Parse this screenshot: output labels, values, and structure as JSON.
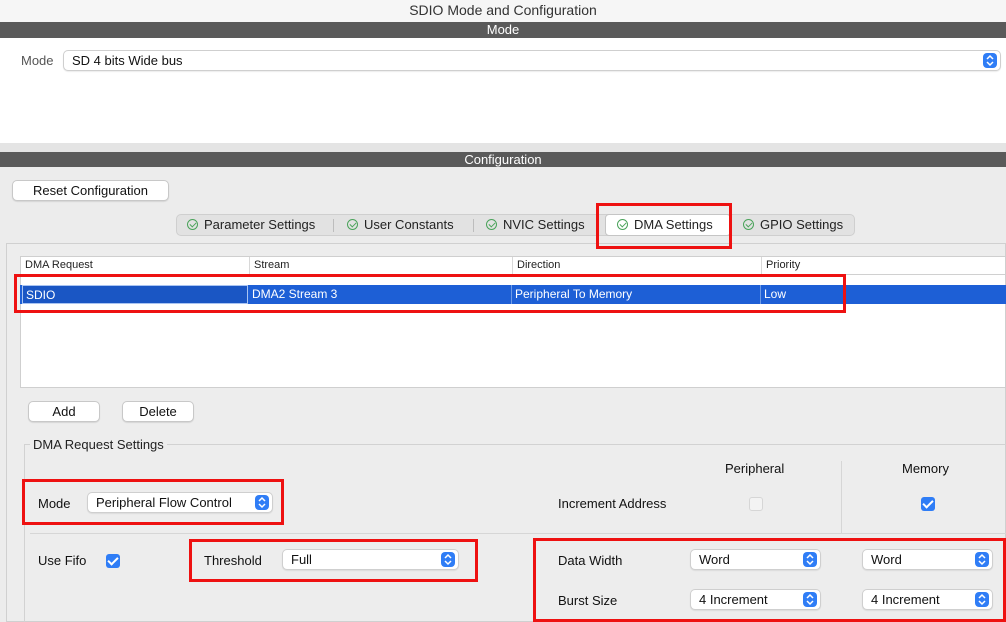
{
  "window": {
    "title": "SDIO Mode and Configuration"
  },
  "mode_section": {
    "header": "Mode",
    "mode_label": "Mode",
    "mode_value": "SD 4 bits Wide bus"
  },
  "config_section": {
    "header": "Configuration",
    "reset_button": "Reset Configuration",
    "tabs": [
      {
        "label": "Parameter Settings"
      },
      {
        "label": "User Constants"
      },
      {
        "label": "NVIC Settings"
      },
      {
        "label": "DMA Settings"
      },
      {
        "label": "GPIO Settings"
      }
    ],
    "active_tab": "DMA Settings"
  },
  "dma_table": {
    "columns": [
      "DMA Request",
      "Stream",
      "Direction",
      "Priority"
    ],
    "rows": [
      {
        "request": "SDIO",
        "stream": "DMA2 Stream 3",
        "direction": "Peripheral To Memory",
        "priority": "Low"
      }
    ],
    "add_button": "Add",
    "delete_button": "Delete"
  },
  "dma_request_settings": {
    "title": "DMA Request Settings",
    "peripheral_header": "Peripheral",
    "memory_header": "Memory",
    "mode_label": "Mode",
    "mode_value": "Peripheral Flow Control",
    "increment_address_label": "Increment Address",
    "increment_peripheral": false,
    "increment_memory": true,
    "use_fifo_label": "Use Fifo",
    "use_fifo": true,
    "threshold_label": "Threshold",
    "threshold_value": "Full",
    "data_width_label": "Data Width",
    "data_width_peripheral": "Word",
    "data_width_memory": "Word",
    "burst_size_label": "Burst Size",
    "burst_size_peripheral": "4 Increment",
    "burst_size_memory": "4 Increment"
  },
  "colors": {
    "selection": "#1d5fd6",
    "highlight": "#ee1111",
    "accent": "#2f7df6",
    "header_bar": "#5a5a5a"
  }
}
